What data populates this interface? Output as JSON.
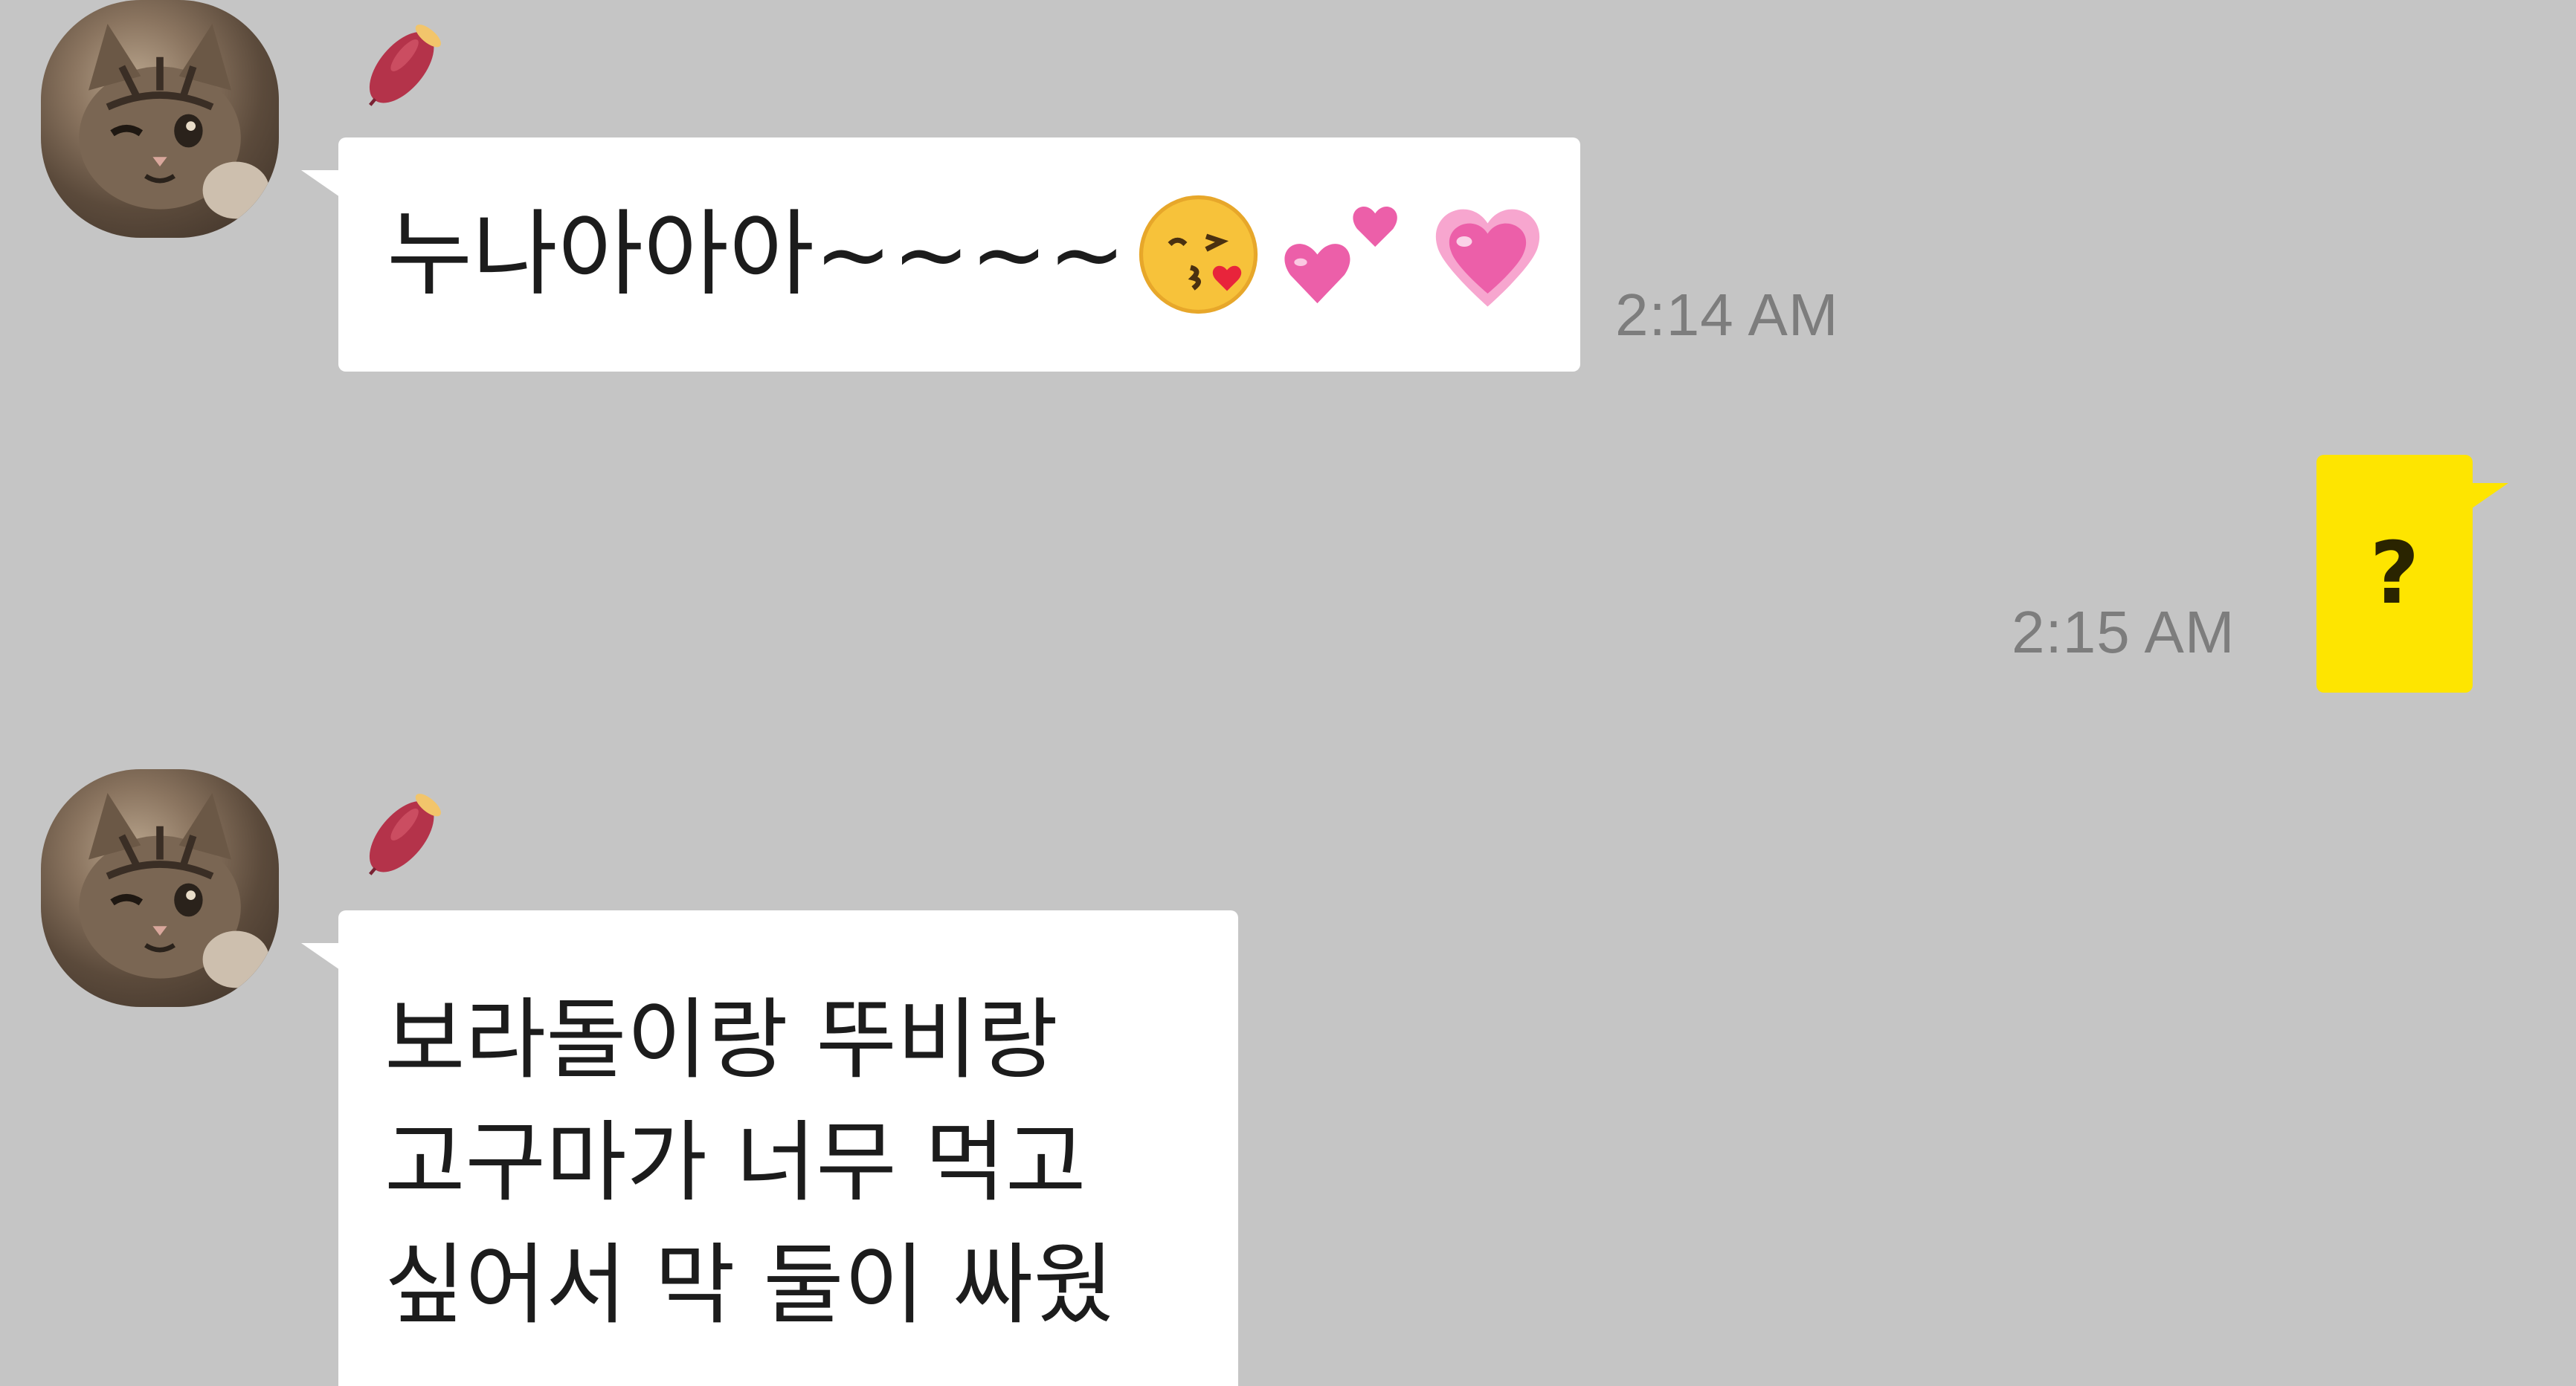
{
  "messages": [
    {
      "sender": "other",
      "text": "누나아아아~~~~",
      "emojis": [
        "kiss-emoji",
        "two-hearts-emoji",
        "growing-heart-emoji"
      ],
      "time": "2:14 AM"
    },
    {
      "sender": "me",
      "text": "?",
      "time": "2:15 AM"
    },
    {
      "sender": "other",
      "text": "보라돌이랑 뚜비랑\n고구마가 너무 먹고\n싶어서 막 둘이 싸웠"
    }
  ],
  "icons": {
    "nickname_badge": "sweet-potato-icon",
    "avatar": "cat-avatar"
  },
  "colors": {
    "background": "#c5c5c5",
    "incoming_bubble": "#ffffff",
    "outgoing_bubble": "#fee500",
    "timestamp": "#7d7d7d"
  }
}
